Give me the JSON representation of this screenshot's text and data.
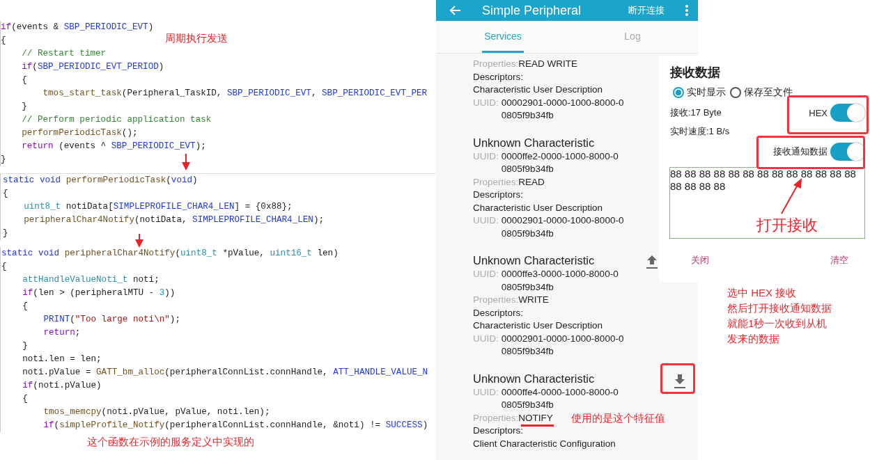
{
  "code_blocks": [
    {
      "lines": [
        {
          "tokens": [
            {
              "kind": "keyword",
              "text": "if"
            },
            {
              "kind": "plain",
              "text": "(events & "
            },
            {
              "kind": "macro",
              "text": "SBP_PERIODIC_EVT"
            },
            {
              "kind": "plain",
              "text": ")"
            }
          ]
        },
        {
          "tokens": [
            {
              "kind": "plain",
              "text": "{"
            }
          ]
        },
        {
          "tokens": [
            {
              "kind": "comment",
              "text": "    // Restart timer"
            }
          ]
        },
        {
          "tokens": [
            {
              "kind": "keyword",
              "text": "    if"
            },
            {
              "kind": "plain",
              "text": "("
            },
            {
              "kind": "macro",
              "text": "SBP_PERIODIC_EVT_PERIOD"
            },
            {
              "kind": "plain",
              "text": ")"
            }
          ]
        },
        {
          "tokens": [
            {
              "kind": "plain",
              "text": "    {"
            }
          ]
        },
        {
          "tokens": [
            {
              "kind": "function",
              "text": "        tmos_start_task"
            },
            {
              "kind": "plain",
              "text": "(Peripheral_TaskID, "
            },
            {
              "kind": "macro",
              "text": "SBP_PERIODIC_EVT"
            },
            {
              "kind": "plain",
              "text": ", "
            },
            {
              "kind": "macro",
              "text": "SBP_PERIODIC_EVT_PER"
            }
          ]
        },
        {
          "tokens": [
            {
              "kind": "plain",
              "text": "    }"
            }
          ]
        },
        {
          "tokens": [
            {
              "kind": "comment",
              "text": "    // Perform periodic application task"
            }
          ]
        },
        {
          "tokens": [
            {
              "kind": "function",
              "text": "    performPeriodicTask"
            },
            {
              "kind": "plain",
              "text": "();"
            }
          ]
        },
        {
          "tokens": [
            {
              "kind": "keyword",
              "text": "    return"
            },
            {
              "kind": "plain",
              "text": " (events ^ "
            },
            {
              "kind": "macro",
              "text": "SBP_PERIODIC_EVT"
            },
            {
              "kind": "plain",
              "text": ");"
            }
          ]
        },
        {
          "tokens": [
            {
              "kind": "plain",
              "text": "}"
            }
          ]
        }
      ]
    },
    {
      "lines": [
        {
          "tokens": [
            {
              "kind": "storage",
              "text": "static void"
            },
            {
              "kind": "function",
              "text": " performPeriodicTask"
            },
            {
              "kind": "plain",
              "text": "("
            },
            {
              "kind": "storage",
              "text": "void"
            },
            {
              "kind": "plain",
              "text": ")"
            }
          ]
        },
        {
          "tokens": [
            {
              "kind": "plain",
              "text": "{"
            }
          ]
        },
        {
          "tokens": [
            {
              "kind": "type",
              "text": "    uint8_t"
            },
            {
              "kind": "plain",
              "text": " notiData["
            },
            {
              "kind": "macro",
              "text": "SIMPLEPROFILE_CHAR4_LEN"
            },
            {
              "kind": "plain",
              "text": "] = {0x88};"
            }
          ]
        },
        {
          "tokens": [
            {
              "kind": "function",
              "text": "    peripheralChar4Notify"
            },
            {
              "kind": "plain",
              "text": "(notiData, "
            },
            {
              "kind": "macro",
              "text": "SIMPLEPROFILE_CHAR4_LEN"
            },
            {
              "kind": "plain",
              "text": ");"
            }
          ]
        },
        {
          "tokens": [
            {
              "kind": "plain",
              "text": "}"
            }
          ]
        }
      ]
    },
    {
      "lines": [
        {
          "tokens": [
            {
              "kind": "storage",
              "text": "static void"
            },
            {
              "kind": "function",
              "text": " peripheralChar4Notify"
            },
            {
              "kind": "plain",
              "text": "("
            },
            {
              "kind": "type",
              "text": "uint8_t"
            },
            {
              "kind": "plain",
              "text": " *pValue, "
            },
            {
              "kind": "type",
              "text": "uint16_t"
            },
            {
              "kind": "plain",
              "text": " len)"
            }
          ]
        },
        {
          "tokens": [
            {
              "kind": "plain",
              "text": "{"
            }
          ]
        },
        {
          "tokens": [
            {
              "kind": "type",
              "text": "    attHandleValueNoti_t"
            },
            {
              "kind": "plain",
              "text": " noti;"
            }
          ]
        },
        {
          "tokens": [
            {
              "kind": "keyword",
              "text": "    if"
            },
            {
              "kind": "plain",
              "text": "(len > (peripheralMTU - "
            },
            {
              "kind": "number",
              "text": "3"
            },
            {
              "kind": "plain",
              "text": "))"
            }
          ]
        },
        {
          "tokens": [
            {
              "kind": "plain",
              "text": "    {"
            }
          ]
        },
        {
          "tokens": [
            {
              "kind": "macro",
              "text": "        PRINT"
            },
            {
              "kind": "plain",
              "text": "("
            },
            {
              "kind": "string",
              "text": "\"Too large noti\\n\""
            },
            {
              "kind": "plain",
              "text": ");"
            }
          ]
        },
        {
          "tokens": [
            {
              "kind": "keyword",
              "text": "        return"
            },
            {
              "kind": "plain",
              "text": ";"
            }
          ]
        },
        {
          "tokens": [
            {
              "kind": "plain",
              "text": "    }"
            }
          ]
        },
        {
          "tokens": [
            {
              "kind": "plain",
              "text": "    noti.len = len;"
            }
          ]
        },
        {
          "tokens": [
            {
              "kind": "plain",
              "text": "    noti.pValue = "
            },
            {
              "kind": "function",
              "text": "GATT_bm_alloc"
            },
            {
              "kind": "plain",
              "text": "(peripheralConnList.connHandle, "
            },
            {
              "kind": "macro",
              "text": "ATT_HANDLE_VALUE_N"
            }
          ]
        },
        {
          "tokens": [
            {
              "kind": "keyword",
              "text": "    if"
            },
            {
              "kind": "plain",
              "text": "(noti.pValue)"
            }
          ]
        },
        {
          "tokens": [
            {
              "kind": "plain",
              "text": "    {"
            }
          ]
        },
        {
          "tokens": [
            {
              "kind": "function",
              "text": "        tmos_memcpy"
            },
            {
              "kind": "plain",
              "text": "(noti.pValue, pValue, noti.len);"
            }
          ]
        },
        {
          "tokens": [
            {
              "kind": "keyword",
              "text": "        if"
            },
            {
              "kind": "plain",
              "text": "("
            },
            {
              "kind": "function",
              "text": "simpleProfile_Notify"
            },
            {
              "kind": "plain",
              "text": "(peripheralConnList.connHandle, &noti) != "
            },
            {
              "kind": "macro",
              "text": "SUCCESS"
            },
            {
              "kind": "plain",
              "text": ")"
            }
          ]
        }
      ]
    }
  ],
  "app_bar": {
    "title": "Simple Peripheral",
    "action": "断开连接"
  },
  "tabs": [
    {
      "label": "Services",
      "selected": true
    },
    {
      "label": "Log",
      "selected": false
    }
  ],
  "characteristics": [
    {
      "kind": "plain",
      "properties_label": "Properties:",
      "properties": "READ WRITE",
      "descriptors_label": "Descriptors:",
      "descriptors": [
        {
          "name": "Characteristic User Description",
          "uuid_label": "UUID:",
          "uuid": [
            "00002901-0000-1000-8000-0",
            "0805f9b34fb"
          ]
        }
      ]
    },
    {
      "kind": "plain",
      "title": "Unknown Characteristic",
      "uuid_label": "UUID:",
      "uuid": [
        "0000ffe2-0000-1000-8000-0",
        "0805f9b34fb"
      ],
      "properties_label": "Properties:",
      "properties": "READ",
      "descriptors_label": "Descriptors:",
      "descriptors": [
        {
          "name": "Characteristic User Description",
          "uuid_label": "UUID:",
          "uuid": [
            "00002901-0000-1000-8000-0",
            "0805f9b34fb"
          ]
        }
      ]
    },
    {
      "kind": "upload",
      "title": "Unknown Characteristic",
      "uuid_label": "UUID:",
      "uuid": [
        "0000ffe3-0000-1000-8000-0",
        "0805f9b34fb"
      ],
      "properties_label": "Properties:",
      "properties": "WRITE",
      "descriptors_label": "Descriptors:",
      "descriptors": [
        {
          "name": "Characteristic User Description",
          "uuid_label": "UUID:",
          "uuid": [
            "00002901-0000-1000-8000-0",
            "0805f9b34fb"
          ]
        }
      ]
    },
    {
      "kind": "download",
      "title": "Unknown Characteristic",
      "uuid_label": "UUID:",
      "uuid": [
        "0000ffe4-0000-1000-8000-0",
        "0805f9b34fb"
      ],
      "properties_label": "Properties:",
      "properties": "NOTIFY",
      "descriptors_label": "Descriptors:",
      "descriptors": [
        {
          "name": "Client Characteristic Configuration"
        }
      ]
    }
  ],
  "dialog": {
    "title": "接收数据",
    "modes": [
      {
        "label": "实时显示",
        "selected": true
      },
      {
        "label": "保存至文件",
        "selected": false
      }
    ],
    "received": "接收:17 Byte",
    "speed": "实时速度:1 B/s",
    "hex": {
      "label": "HEX",
      "on": true
    },
    "notify": {
      "label": "接收通知数据",
      "on": true
    },
    "output": "88 88 88 88 88 88 88 88 88 88 88 88 88 88 88 88 88",
    "buttons": [
      "关闭",
      "清空"
    ]
  },
  "notes": {
    "periodic_send": "周期执行发送",
    "implemented": "这个函数在示例的服务定义中实现的",
    "characteristic": "使用的是这个特征值",
    "open_receive": "打开接收",
    "steps": [
      "选中 HEX 接收",
      "然后打开接收通知数据",
      "就能1秒一次收到从机",
      "发来的数据"
    ]
  }
}
